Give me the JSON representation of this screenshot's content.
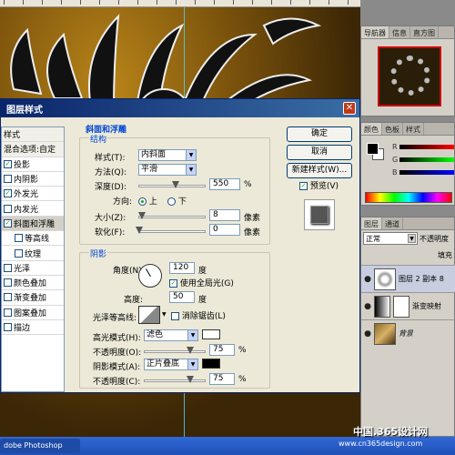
{
  "canvas": {
    "ruler_marks": [
      1,
      2,
      3,
      4,
      5,
      6,
      7,
      8,
      9,
      10,
      11,
      12,
      13,
      14,
      15,
      16,
      17,
      18,
      19
    ]
  },
  "navigator_panel": {
    "tabs": [
      "导航器",
      "信息",
      "直方图"
    ]
  },
  "color_panel": {
    "tabs": [
      "颜色",
      "色板",
      "样式"
    ],
    "rows": [
      "R",
      "G",
      "B"
    ]
  },
  "layers_panel": {
    "tabs": [
      "图层",
      "通道"
    ],
    "blend_mode": "正常",
    "opacity_label": "不透明度",
    "fill_label": "填充",
    "layers": [
      {
        "name": "图层 2 副本 8",
        "selected": true
      },
      {
        "name": "渐变映射",
        "selected": false
      },
      {
        "name": "背景",
        "selected": false
      }
    ]
  },
  "dialog": {
    "title": "图层样式",
    "list_header": "样式",
    "blend_options": "混合选项:自定",
    "styles": [
      {
        "label": "投影",
        "checked": true
      },
      {
        "label": "内阴影",
        "checked": false
      },
      {
        "label": "外发光",
        "checked": true
      },
      {
        "label": "内发光",
        "checked": false
      },
      {
        "label": "斜面和浮雕",
        "checked": true,
        "selected": true
      },
      {
        "label": "等高线",
        "checked": false,
        "sub": true
      },
      {
        "label": "纹理",
        "checked": false,
        "sub": true
      },
      {
        "label": "光泽",
        "checked": false
      },
      {
        "label": "颜色叠加",
        "checked": false
      },
      {
        "label": "渐变叠加",
        "checked": false
      },
      {
        "label": "图案叠加",
        "checked": false
      },
      {
        "label": "描边",
        "checked": false
      }
    ],
    "section_title": "斜面和浮雕",
    "structure": {
      "title": "结构",
      "style_label": "样式(T):",
      "style_value": "内斜面",
      "method_label": "方法(Q):",
      "method_value": "平滑",
      "depth_label": "深度(D):",
      "depth_value": "550",
      "depth_unit": "%",
      "depth_fraction": 0.55,
      "direction_label": "方向:",
      "dir_up": "上",
      "dir_down": "下",
      "size_label": "大小(Z):",
      "size_value": "8",
      "size_unit": "像素",
      "size_fraction": 0.04,
      "soften_label": "软化(F):",
      "soften_value": "0",
      "soften_unit": "像素",
      "soften_fraction": 0.0
    },
    "shading": {
      "title": "阴影",
      "angle_label": "角度(N):",
      "angle_value": "120",
      "angle_unit": "度",
      "global_light_label": "使用全局光(G)",
      "global_light_checked": true,
      "altitude_label": "高度:",
      "altitude_value": "50",
      "altitude_unit": "度",
      "gloss_contour_label": "光泽等高线:",
      "antialias_label": "消除锯齿(L)",
      "antialias_checked": false,
      "highlight_mode_label": "高光模式(H):",
      "highlight_mode_value": "滤色",
      "highlight_color": "#ffffff",
      "highlight_opacity_label": "不透明度(O):",
      "highlight_opacity_value": "75",
      "highlight_opacity_fraction": 0.75,
      "shadow_mode_label": "阴影模式(A):",
      "shadow_mode_value": "正片叠底",
      "shadow_color": "#000000",
      "shadow_opacity_label": "不透明度(C):",
      "shadow_opacity_value": "75",
      "shadow_opacity_fraction": 0.75,
      "percent": "%"
    },
    "buttons": {
      "ok": "确定",
      "cancel": "取消",
      "new_style": "新建样式(W)..."
    },
    "preview_label": "预览(V)",
    "preview_checked": true
  },
  "taskbar": {
    "app": "dobe Photoshop"
  },
  "watermark": {
    "line1": "中国.365设计网",
    "line2": "www.cn365design.com"
  },
  "colors": {
    "title_bar": "#0a246a",
    "accent_blue": "#0046d5",
    "check_green": "#21a121"
  }
}
